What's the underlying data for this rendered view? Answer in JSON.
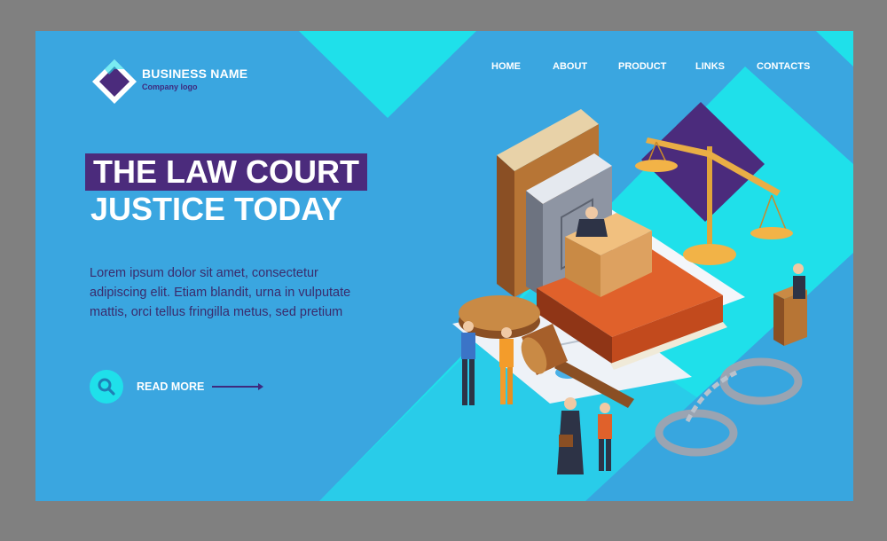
{
  "brand": {
    "name": "BUSINESS NAME",
    "tagline": "Company logo"
  },
  "nav": {
    "items": [
      {
        "label": "HOME"
      },
      {
        "label": "ABOUT"
      },
      {
        "label": "PRODUCT"
      },
      {
        "label": "LINKS"
      },
      {
        "label": "CONTACTS"
      }
    ]
  },
  "hero": {
    "title_line1": "THE LAW COURT",
    "title_line2": "JUSTICE TODAY",
    "body_lines": [
      "Lorem ipsum dolor sit amet, consectetur",
      "adipiscing elit. Etiam blandit, urna in vulputate",
      "mattis, orci tellus fringilla metus, sed pretium"
    ],
    "cta_label": "READ MORE"
  },
  "colors": {
    "background": "#3aa6e0",
    "accent_cyan": "#1fe0ea",
    "accent_purple": "#4b2b7c",
    "frame": "#808080"
  },
  "icons": {
    "logo": "diamond-logo-icon",
    "cta": "search-icon",
    "arrow": "arrow-right-icon"
  }
}
